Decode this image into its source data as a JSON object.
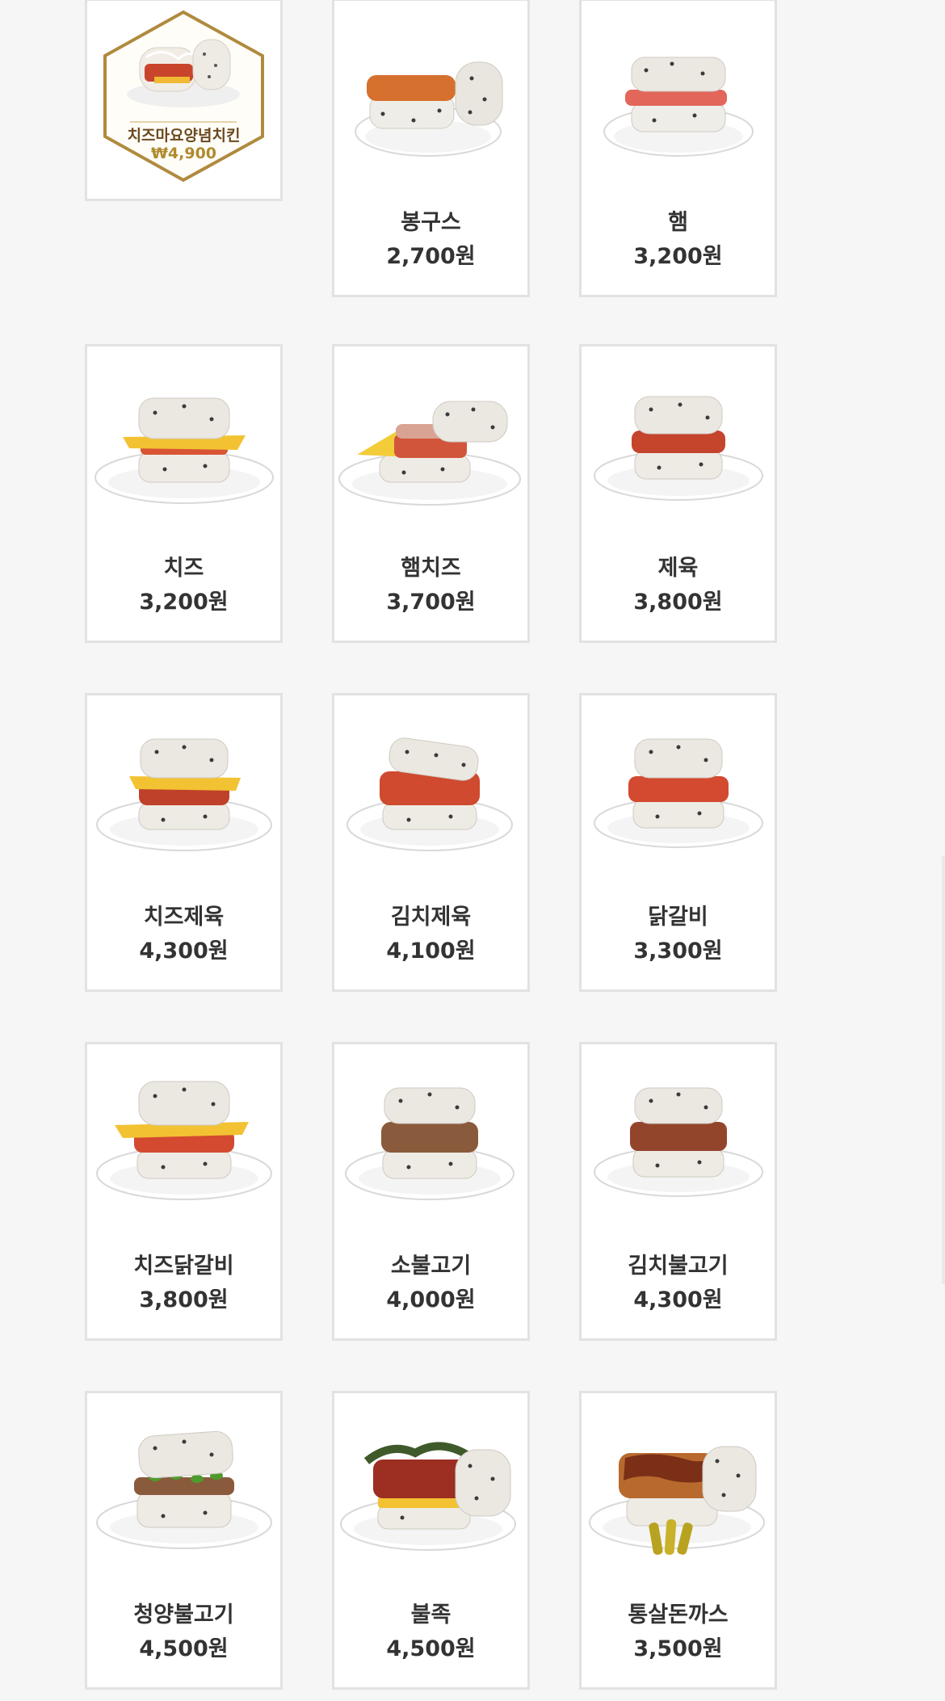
{
  "featured": {
    "name": "치즈마요양념치킨",
    "price": "₩4,900"
  },
  "menu": [
    {
      "name": "봉구스",
      "price": "2,700원",
      "icon": "rice-burger-plain-icon"
    },
    {
      "name": "햄",
      "price": "3,200원",
      "icon": "rice-burger-ham-icon"
    },
    {
      "name": "치즈",
      "price": "3,200원",
      "icon": "rice-burger-cheese-icon"
    },
    {
      "name": "햄치즈",
      "price": "3,700원",
      "icon": "rice-burger-ham-cheese-icon"
    },
    {
      "name": "제육",
      "price": "3,800원",
      "icon": "rice-burger-pork-icon"
    },
    {
      "name": "치즈제육",
      "price": "4,300원",
      "icon": "rice-burger-cheese-pork-icon"
    },
    {
      "name": "김치제육",
      "price": "4,100원",
      "icon": "rice-burger-kimchi-pork-icon"
    },
    {
      "name": "닭갈비",
      "price": "3,300원",
      "icon": "rice-burger-dakgalbi-icon"
    },
    {
      "name": "치즈닭갈비",
      "price": "3,800원",
      "icon": "rice-burger-cheese-dakgalbi-icon"
    },
    {
      "name": "소불고기",
      "price": "4,000원",
      "icon": "rice-burger-bulgogi-icon"
    },
    {
      "name": "김치불고기",
      "price": "4,300원",
      "icon": "rice-burger-kimchi-bulgogi-icon"
    },
    {
      "name": "청양불고기",
      "price": "4,500원",
      "icon": "rice-burger-cheongyang-bulgogi-icon"
    },
    {
      "name": "불족",
      "price": "4,500원",
      "icon": "rice-burger-buljok-icon"
    },
    {
      "name": "통살돈까스",
      "price": "3,500원",
      "icon": "rice-burger-donkatsu-icon"
    }
  ]
}
